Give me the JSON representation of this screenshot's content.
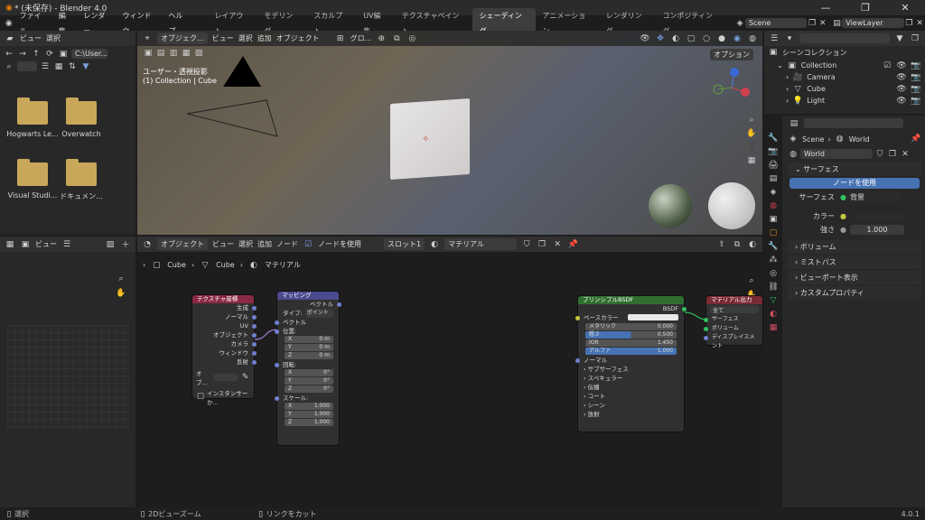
{
  "window": {
    "title": "* (未保存) - Blender 4.0",
    "controls": [
      "—",
      "❐",
      "✕"
    ]
  },
  "menu": {
    "items": [
      "ファイル",
      "編集",
      "レンダー",
      "ウィンドウ",
      "ヘルプ"
    ]
  },
  "workspaces": [
    "レイアウト",
    "モデリング",
    "スカルプト",
    "UV編集",
    "テクスチャペイント",
    "シェーディング",
    "アニメーション",
    "レンダリング",
    "コンポジティング"
  ],
  "scene": {
    "name": "Scene",
    "view_layer": "ViewLayer"
  },
  "filebrowser": {
    "header": [
      "ビュー",
      "選択"
    ],
    "path": "C:\\User...",
    "items": [
      {
        "name": "Hogwarts Le..."
      },
      {
        "name": "Overwatch"
      },
      {
        "name": "Visual Studi..."
      },
      {
        "name": "ドキュメン..."
      }
    ]
  },
  "viewport": {
    "mode": "オブジェク...",
    "menus": [
      "ビュー",
      "選択",
      "追加",
      "オブジェクト"
    ],
    "orient": "グロ...",
    "label1": "ユーザー・透視投影",
    "label2": "(1) Collection | Cube",
    "options": "オプション"
  },
  "imageeditor": {
    "view": "ビュー"
  },
  "nodeeditor": {
    "mode": "オブジェクト",
    "menus": [
      "ビュー",
      "選択",
      "追加",
      "ノード"
    ],
    "use_nodes": "ノードを使用",
    "slot": "スロット1",
    "material": "マテリアル",
    "breadcrumb": [
      "Cube",
      "Cube",
      "マテリアル"
    ]
  },
  "nodes": {
    "texcoord": {
      "title": "テクスチャ座標",
      "outputs": [
        "生成",
        "ノーマル",
        "UV",
        "オブジェクト",
        "カメラ",
        "ウィンドウ",
        "反射"
      ],
      "obj_label": "オブ...",
      "instancer": "インスタンサーか..."
    },
    "mapping": {
      "title": "マッピング",
      "output": "ベクトル",
      "type_label": "タイプ:",
      "type_value": "ポイント",
      "vector": "ベクトル",
      "location": "位置:",
      "rotation": "回転:",
      "scale": "スケール:",
      "loc": [
        [
          "X",
          "0 m"
        ],
        [
          "Y",
          "0 m"
        ],
        [
          "Z",
          "0 m"
        ]
      ],
      "rot": [
        [
          "X",
          "0°"
        ],
        [
          "Y",
          "0°"
        ],
        [
          "Z",
          "0°"
        ]
      ],
      "scl": [
        [
          "X",
          "1.000"
        ],
        [
          "Y",
          "1.000"
        ],
        [
          "Z",
          "1.000"
        ]
      ]
    },
    "bsdf": {
      "title": "プリンシプルBSDF",
      "output": "BSDF",
      "basecolor": "ベースカラー",
      "metallic": [
        "メタリック",
        "0.000"
      ],
      "roughness": [
        "粗さ",
        "0.500"
      ],
      "ior": [
        "IOR",
        "1.450"
      ],
      "alpha": [
        "アルファ",
        "1.000"
      ],
      "normal": "ノーマル",
      "sections": [
        "サブサーフェス",
        "スペキュラー",
        "伝播",
        "コート",
        "シーン",
        "放射"
      ]
    },
    "output": {
      "title": "マテリアル出力",
      "target": "全て",
      "inputs": [
        "サーフェス",
        "ボリューム",
        "ディスプレイスメント"
      ]
    }
  },
  "outliner": {
    "title": "シーンコレクション",
    "items": [
      "Collection",
      "Camera",
      "Cube",
      "Light"
    ]
  },
  "properties": {
    "breadcrumb": [
      "Scene",
      "World"
    ],
    "world": "World",
    "surface_section": "サーフェス",
    "use_nodes": "ノードを使用",
    "surface_label": "サーフェス",
    "surface_value": "背景",
    "color_label": "カラー",
    "strength_label": "強さ",
    "strength_value": "1.000",
    "sections": [
      "ボリューム",
      "ミストパス",
      "ビューポート表示",
      "カスタムプロパティ"
    ]
  },
  "status": {
    "items": [
      "選択",
      "2Dビューズーム",
      "リンクをカット"
    ],
    "version": "4.0.1"
  },
  "colors": {
    "texcoord": "#8a2a45",
    "mapping": "#4a4a8e",
    "bsdf": "#2f6e2f",
    "output": "#7a2a34",
    "accent": "#4772b3"
  }
}
